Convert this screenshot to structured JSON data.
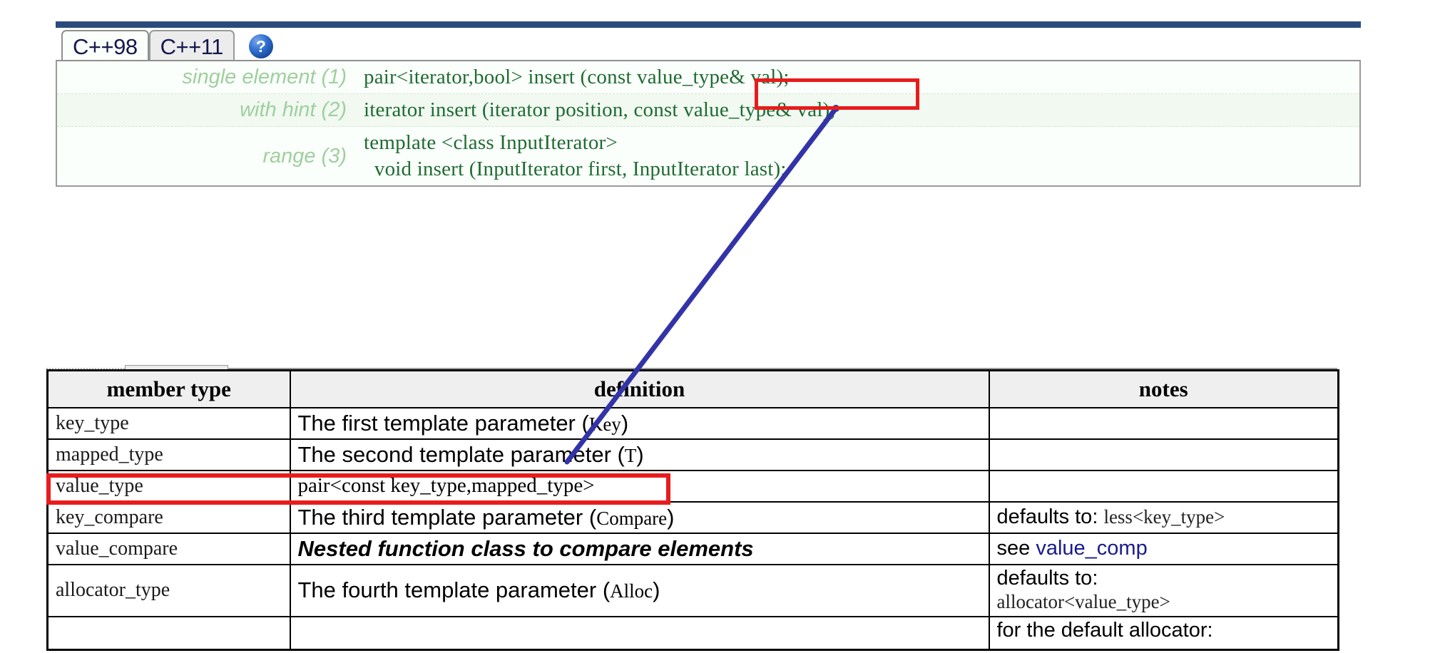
{
  "signature_panel": {
    "tabs": [
      {
        "label": "C++98",
        "state": "active"
      },
      {
        "label": "C++11",
        "state": "inactive"
      }
    ],
    "help_icon": {
      "name": "help-question-icon",
      "glyph": "?"
    },
    "rows": [
      {
        "label": "single element (1)",
        "code": "pair<iterator,bool> insert (const value_type& val);"
      },
      {
        "label": "with hint (2)",
        "code": "iterator insert (iterator position, const value_type& val);"
      },
      {
        "label": "range (3)",
        "code": "template <class InputIterator>\n  void insert (InputIterator first, InputIterator last);"
      }
    ]
  },
  "annotations": {
    "highlight_color": "#e81c1c",
    "arrow_color": "#3333a8",
    "signature_highlight_text": "value_type& val",
    "table_highlight_text": "value_type   pair<const key_type,mapped_type>"
  },
  "member_table": {
    "headers": [
      "member type",
      "definition",
      "notes"
    ],
    "rows": [
      {
        "member": "key_type",
        "definition_prefix": "The first template parameter (",
        "definition_mono": "Key",
        "definition_suffix": ")",
        "notes_plain": "",
        "notes_mono": "",
        "notes_link": ""
      },
      {
        "member": "mapped_type",
        "definition_prefix": "The second template parameter (",
        "definition_mono": "T",
        "definition_suffix": ")",
        "notes_plain": "",
        "notes_mono": "",
        "notes_link": ""
      },
      {
        "member": "value_type",
        "definition_code": "pair<const key_type,mapped_type>",
        "notes_plain": "",
        "notes_mono": "",
        "notes_link": ""
      },
      {
        "member": "key_compare",
        "definition_prefix": "The third template parameter (",
        "definition_mono": "Compare",
        "definition_suffix": ")",
        "notes_plain": "defaults to: ",
        "notes_mono": "less<key_type>",
        "notes_link": ""
      },
      {
        "member": "value_compare",
        "definition_italic": "Nested function class to compare elements",
        "notes_plain": "see ",
        "notes_mono": "",
        "notes_link": "value_comp"
      },
      {
        "member": "allocator_type",
        "definition_prefix": "The fourth template parameter (",
        "definition_mono": "Alloc",
        "definition_suffix": ")",
        "notes_plain": "defaults to:",
        "notes_mono": "allocator<value_type>",
        "notes_link": ""
      },
      {
        "member": "",
        "definition_prefix": "",
        "definition_mono": "",
        "definition_suffix": "",
        "notes_plain": "for the default allocator:",
        "notes_mono": "",
        "notes_link": ""
      }
    ]
  }
}
